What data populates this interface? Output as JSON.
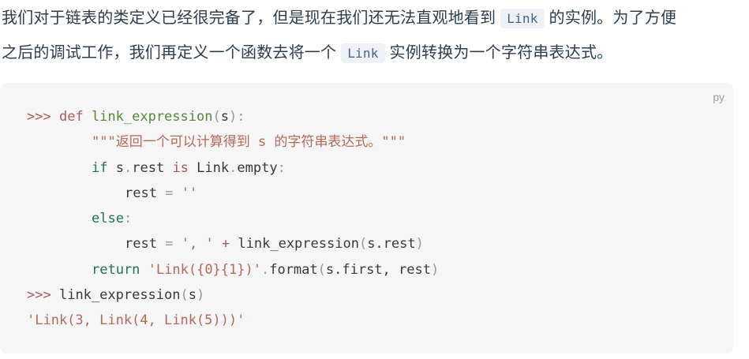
{
  "paragraph": {
    "line1_before": "我们对于链表的类定义已经很完备了，但是现在我们还无法直观地看到",
    "line1_code": "Link",
    "line1_after": "的实例。为了方便",
    "line2_before": "之后的调试工作，我们再定义一个函数去将一个",
    "line2_code": "Link",
    "line2_after": "实例转换为一个字符串表达式。"
  },
  "code_block": {
    "language": "py",
    "lines": {
      "l1_prompt": ">>>",
      "l1_def": "def",
      "l1_fn": "link_expression",
      "l1_open": "(",
      "l1_param": "s",
      "l1_close": "):",
      "l2_doc": "\"\"\"返回一个可以计算得到 s 的字符串表达式。\"\"\"",
      "l3_if": "if",
      "l3_s": "s",
      "l3_dot": ".",
      "l3_rest": "rest",
      "l3_is": "is",
      "l3_link": "Link",
      "l3_dot2": ".",
      "l3_empty": "empty",
      "l3_colon": ":",
      "l4_rest": "rest",
      "l4_eq": "=",
      "l4_str": "''",
      "l5_else": "else",
      "l5_colon": ":",
      "l6_rest": "rest",
      "l6_eq": "=",
      "l6_str": "', '",
      "l6_plus": "+",
      "l6_fn": "link_expression",
      "l6_open": "(",
      "l6_arg": "s.rest",
      "l6_close": ")",
      "l7_return": "return",
      "l7_str": "'Link({0}{1})'",
      "l7_dot": ".",
      "l7_format": "format",
      "l7_open": "(",
      "l7_args": "s.first, rest",
      "l7_close": ")",
      "l8_prompt": ">>>",
      "l8_fn": "link_expression",
      "l8_open": "(",
      "l8_arg": "s",
      "l8_close": ")",
      "l9_output": "'Link(3, Link(4, Link(5)))'"
    }
  },
  "colors": {
    "text": "#2c3e50",
    "inline_code_bg": "#eef1f6",
    "code_bg": "#f6f6f7",
    "keyword": "#1e754f",
    "string": "#b56959",
    "function": "#59873a",
    "operator": "#ab5959"
  }
}
